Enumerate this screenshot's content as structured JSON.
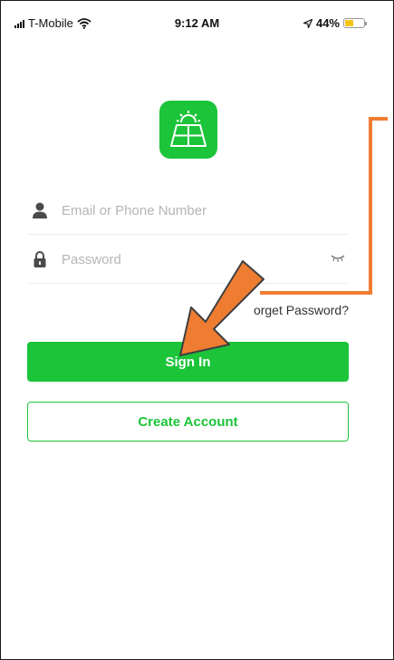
{
  "status_bar": {
    "carrier": "T-Mobile",
    "time": "9:12 AM",
    "battery": "44%",
    "battery_level": 0.44,
    "icons": [
      "signal-icon",
      "wifi-icon",
      "location-arrow-icon",
      "battery-icon"
    ]
  },
  "app": {
    "logo_icon": "solar-panel-icon",
    "brand_color": "#1bc439"
  },
  "login": {
    "email_placeholder": "Email or Phone Number",
    "password_placeholder": "Password",
    "forgot_password": "orget Password?",
    "sign_in": "Sign In",
    "create_account": "Create Account"
  },
  "annotation": {
    "arrow_color": "#ef7d31",
    "callout": "orange-arrow-pointing-to-sign-in"
  }
}
